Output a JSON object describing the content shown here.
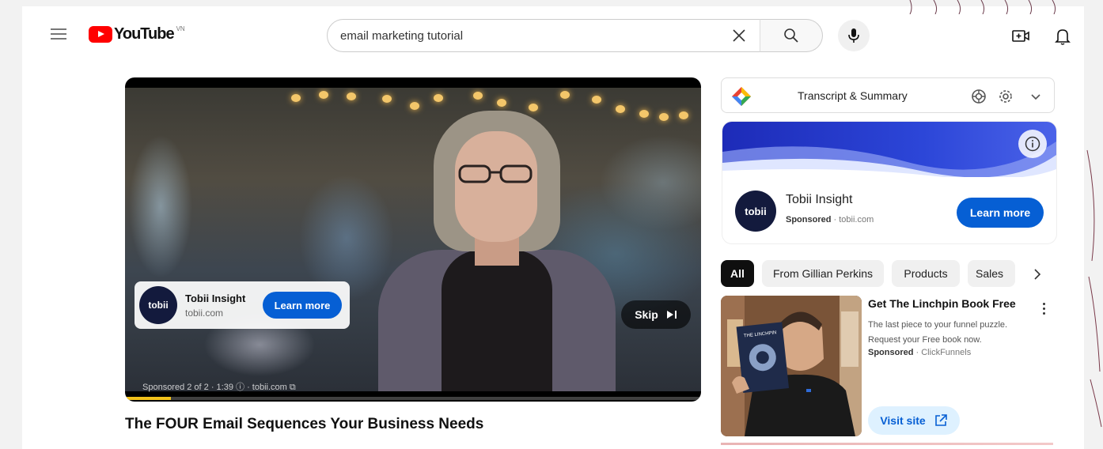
{
  "header": {
    "logo_text": "YouTube",
    "country_code": "VN",
    "search_value": "email marketing tutorial",
    "icons": [
      "menu-icon",
      "clear-icon",
      "search-icon",
      "mic-icon",
      "create-icon",
      "bell-icon"
    ]
  },
  "player": {
    "ad_overlay": {
      "logo_text": "tobii",
      "advertiser": "Tobii Insight",
      "domain": "tobii.com",
      "cta": "Learn more"
    },
    "skip_label": "Skip",
    "ad_status": "Sponsored 2 of 2 · 1:39 ⓘ · tobii.com ⧉",
    "progress_fraction": 0.08,
    "progress_color": "#f3c21b"
  },
  "video": {
    "title": "The FOUR Email Sequences Your Business Needs"
  },
  "transcript_bar": {
    "title": "Transcript & Summary"
  },
  "side_ad": {
    "logo_text": "tobii",
    "advertiser": "Tobii Insight",
    "sponsored_label": "Sponsored",
    "domain": "· tobii.com",
    "cta": "Learn more"
  },
  "chips": [
    {
      "label": "All",
      "active": true
    },
    {
      "label": "From Gillian Perkins",
      "active": false
    },
    {
      "label": "Products",
      "active": false
    },
    {
      "label": "Sales",
      "active": false
    }
  ],
  "recommendation": {
    "title": "Get The Linchpin Book Free",
    "description": "The last piece to your funnel puzzle. Request your Free book now.",
    "sponsored_label": "Sponsored",
    "advertiser": "· ClickFunnels",
    "cta": "Visit site"
  },
  "colors": {
    "brand_red": "#ff0000",
    "accent_blue": "#065fd4",
    "chip_active_bg": "#0f0f0f"
  }
}
